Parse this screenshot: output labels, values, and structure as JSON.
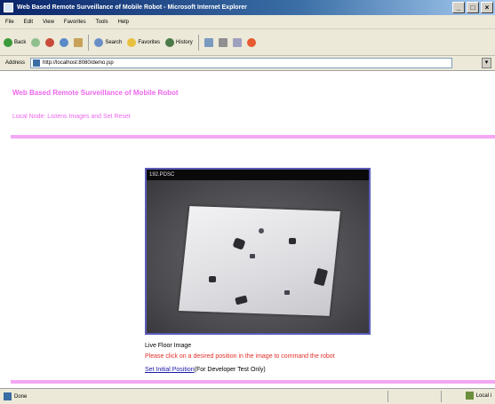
{
  "window": {
    "title": "Web Based Remote Surveillance of Mobile Robot - Microsoft Internet Explorer",
    "minimize_glyph": "_",
    "maximize_glyph": "□",
    "close_glyph": "×"
  },
  "menu": {
    "items": [
      "File",
      "Edit",
      "View",
      "Favorites",
      "Tools",
      "Help"
    ]
  },
  "toolbar": {
    "back_label": "Back",
    "search_label": "Search",
    "favorites_label": "Favorites",
    "history_label": "History"
  },
  "address": {
    "label": "Address",
    "url": "http://localhost:8080/demo.jsp"
  },
  "page": {
    "title": "Web Based Remote Surveillance of Mobile Robot",
    "subtitle": "Local Node: Listens Images and Set Reset",
    "camera_header": "192.PDSC",
    "caption": "Live Floor Image",
    "instruction": "Please click on a desired position in the image to command the robot",
    "link_text": "Set Initial Position",
    "link_suffix": "(For Developer Test Only)"
  },
  "status": {
    "text": "Done",
    "zone": "Local i"
  },
  "colors": {
    "accent_pink": "#ee66ee",
    "instruction_red": "#e0302a",
    "link_blue": "#1a1aa8"
  }
}
